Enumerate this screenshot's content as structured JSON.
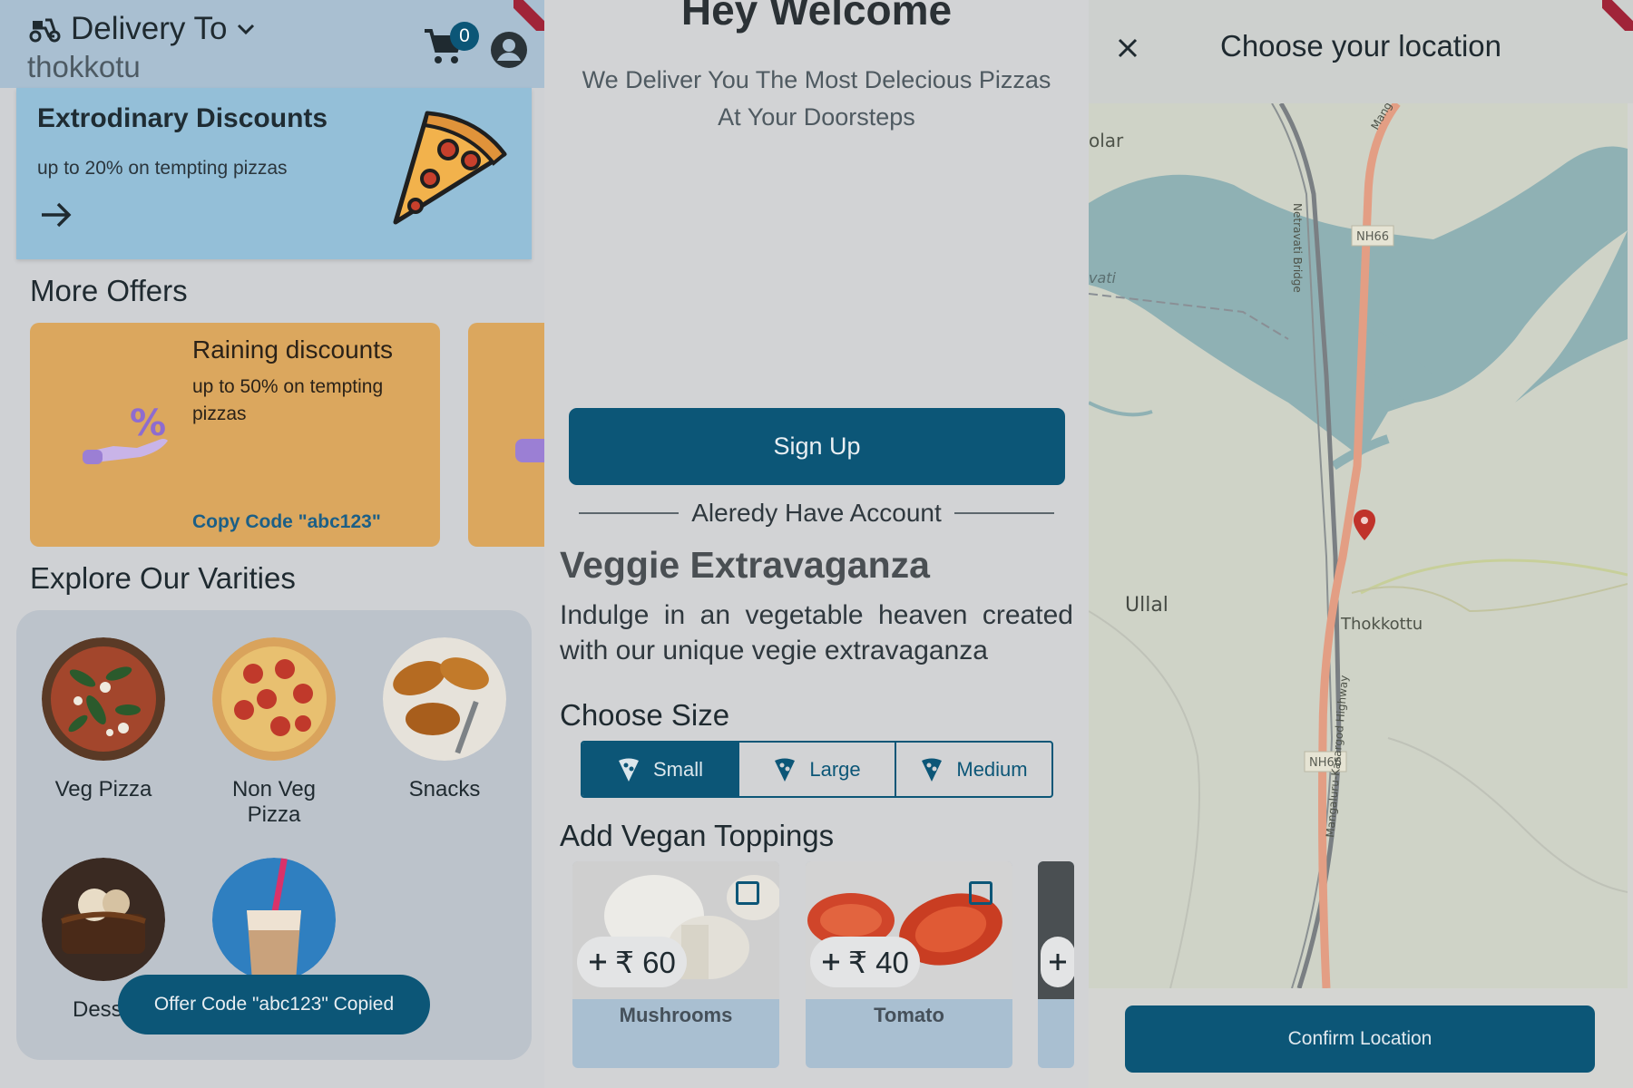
{
  "home": {
    "header": {
      "delivery_label": "Delivery To",
      "location": "thokkotu",
      "cart_count": "0"
    },
    "hero": {
      "title": "Extrodinary Discounts",
      "subtitle": "up to 20% on tempting pizzas"
    },
    "more_offers_title": "More Offers",
    "offer": {
      "title": "Raining discounts",
      "subtitle": "up to 50% on tempting pizzas",
      "code_label": "Copy Code \"abc123\""
    },
    "varieties_title": "Explore Our Varities",
    "categories": [
      {
        "label": "Veg Pizza"
      },
      {
        "label": "Non Veg Pizza"
      },
      {
        "label": "Snacks"
      },
      {
        "label": "Desse"
      },
      {
        "label": ""
      }
    ],
    "toast": "Offer Code \"abc123\" Copied"
  },
  "welcome": {
    "title": "Hey Welcome",
    "tagline_line1": "We Deliver You The Most Delecious Pizzas",
    "tagline_line2": "At Your Doorsteps",
    "signup_label": "Sign Up",
    "have_account": "Aleredy Have Account",
    "dish": {
      "name": "Veggie Extravaganza",
      "desc_line1": "Indulge in an vegetable heaven created",
      "desc_line2": "with our unique vegie extravaganza"
    },
    "choose_size": "Choose Size",
    "sizes": [
      {
        "label": "Small",
        "selected": true
      },
      {
        "label": "Large",
        "selected": false
      },
      {
        "label": "Medium",
        "selected": false
      }
    ],
    "toppings_title": "Add Vegan Toppings",
    "toppings": [
      {
        "name": "Mushrooms",
        "price": "₹ 60"
      },
      {
        "name": "Tomato",
        "price": "₹ 40"
      },
      {
        "name": "",
        "price": ""
      }
    ]
  },
  "location": {
    "title": "Choose your location",
    "confirm_label": "Confirm Location",
    "map_labels": {
      "ullal": "Ullal",
      "thokkottu": "Thokkottu",
      "nh66": "NH66",
      "nh66_b": "NH66",
      "bridge": "Netravati Bridge",
      "highway": "Mangaluru-Kasargod Highway",
      "olar": "olar",
      "vati": "vati",
      "mang": "Mang"
    }
  },
  "colors": {
    "primary": "#0c5677",
    "hero_bg": "#94bfd8",
    "offer_bg": "#dba75e",
    "ribbon": "#a02438",
    "map_water": "#8fb1b4",
    "map_road": "#e39e84"
  }
}
